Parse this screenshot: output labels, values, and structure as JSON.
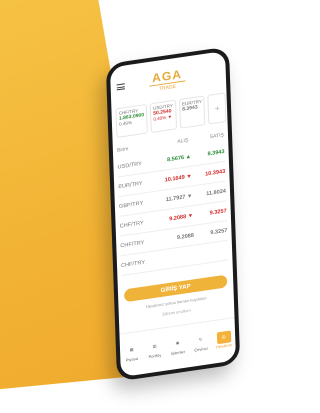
{
  "brand": {
    "logo_text": "AGA",
    "logo_subtext": "TRADE"
  },
  "cards": [
    {
      "label": "CHF/TRY",
      "value": "1.863.0900",
      "change": "0.48%"
    },
    {
      "label": "USD/TRY",
      "value": "50.2540",
      "change": "0.40% ▼"
    },
    {
      "label": "EUR/TRY",
      "value": "8.3943",
      "change": ""
    }
  ],
  "table": {
    "headers": [
      "Birim",
      "ALIŞ",
      "SATIŞ"
    ],
    "rows": [
      {
        "name": "USD/TRY",
        "buy": "8.5676 ▲",
        "sell": "8.3943",
        "buy_state": "up",
        "sell_state": "up"
      },
      {
        "name": "EUR/TRY",
        "buy": "10.1649 ▼",
        "sell": "10.3943",
        "buy_state": "down",
        "sell_state": "down"
      },
      {
        "name": "GBP/TRY",
        "buy": "11.7927 ▼",
        "sell": "11.8024",
        "buy_state": "neutral",
        "sell_state": "neutral"
      },
      {
        "name": "CHF/TRY",
        "buy": "9.2088 ▼",
        "sell": "9.3257",
        "buy_state": "down",
        "sell_state": "down"
      },
      {
        "name": "CHF/TRY",
        "buy": "9.2088",
        "sell": "9.3257",
        "buy_state": "neutral",
        "sell_state": "neutral"
      },
      {
        "name": "CHF/TRY",
        "buy": "",
        "sell": "",
        "buy_state": "neutral",
        "sell_state": "neutral"
      }
    ]
  },
  "cta": {
    "label": "GİRİŞ YAP",
    "hint": "Hesabınız yoksa hemen kaydolun",
    "subhint": "Şifremi unuttum"
  },
  "tabs": [
    {
      "label": "Piyasa",
      "icon": "chart-icon"
    },
    {
      "label": "Portföy",
      "icon": "bars-icon"
    },
    {
      "label": "İşlemler",
      "icon": "coin-icon"
    },
    {
      "label": "Çevirici",
      "icon": "refresh-icon"
    },
    {
      "label": "Hesabım",
      "icon": "user-icon"
    }
  ],
  "colors": {
    "accent": "#F0B33A",
    "background_yellow": "#F2B233",
    "up": "#2F8F3A",
    "down": "#D22A2A"
  }
}
